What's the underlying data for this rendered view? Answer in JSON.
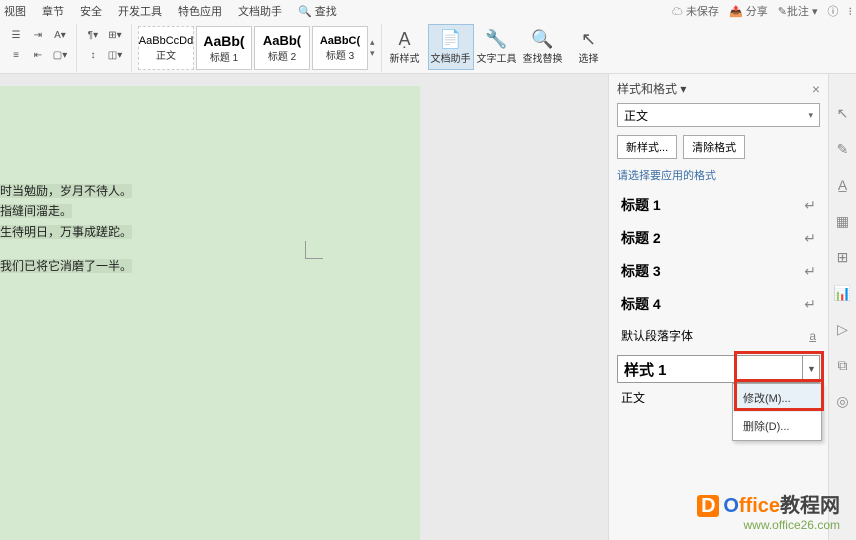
{
  "menu": {
    "items": [
      "视图",
      "章节",
      "安全",
      "开发工具",
      "特色应用",
      "文档助手"
    ],
    "search": "查找",
    "right": {
      "unsaved": "未保存",
      "share": "分享",
      "annotate": "批注"
    }
  },
  "toolbar": {
    "styles": [
      {
        "sample": "AaBbCcDd",
        "name": "正文"
      },
      {
        "sample": "AaBb(",
        "name": "标题 1"
      },
      {
        "sample": "AaBb(",
        "name": "标题 2"
      },
      {
        "sample": "AaBbC(",
        "name": "标题 3"
      }
    ],
    "buttons": {
      "newStyle": "新样式",
      "docAssist": "文档助手",
      "textTool": "文字工具",
      "findReplace": "查找替换",
      "select": "选择"
    }
  },
  "document": {
    "lines": [
      "时当勉励，岁月不待人。",
      "指缝间溜走。",
      "生待明日，万事成蹉跎。",
      "",
      "我们已将它消磨了一半。"
    ]
  },
  "panel": {
    "title": "样式和格式",
    "currentStyle": "正文",
    "newStyleBtn": "新样式...",
    "clearFormat": "清除格式",
    "hint": "请选择要应用的格式",
    "list": [
      {
        "label": "标题 1"
      },
      {
        "label": "标题 2"
      },
      {
        "label": "标题 3"
      },
      {
        "label": "标题 4"
      }
    ],
    "defaultFont": "默认段落字体",
    "styleSelect": "样式 1",
    "ctxModify": "修改(M)...",
    "ctxDelete": "删除(D)...",
    "bodyText": "正文"
  },
  "watermark": {
    "title_a": "O",
    "title_b": "ffice",
    "title_c": "教程网",
    "url": "www.office26.com"
  }
}
